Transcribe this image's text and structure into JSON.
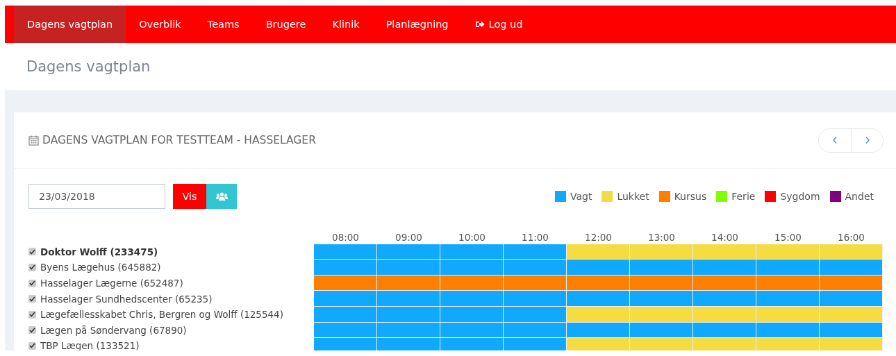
{
  "nav": [
    {
      "label": "Dagens vagtplan",
      "selected": true,
      "kind": "link"
    },
    {
      "label": "Overblik",
      "selected": false,
      "kind": "link"
    },
    {
      "label": "Teams",
      "selected": false,
      "kind": "link"
    },
    {
      "label": "Brugere",
      "selected": false,
      "kind": "link"
    },
    {
      "label": "Klinik",
      "selected": false,
      "kind": "link"
    },
    {
      "label": "Planlægning",
      "selected": false,
      "kind": "link"
    },
    {
      "label": "Log ud",
      "selected": false,
      "kind": "logout"
    }
  ],
  "page_title": "Dagens vagtplan",
  "card": {
    "title": "DAGENS VAGTPLAN FOR TESTTEAM - HASSELAGER",
    "date_field": {
      "value": "23/03/2018"
    },
    "show_button": "Vis",
    "legend": [
      {
        "label": "Vagt",
        "color": "#10a9fe"
      },
      {
        "label": "Lukket",
        "color": "#f4dc42"
      },
      {
        "label": "Kursus",
        "color": "#ff8000"
      },
      {
        "label": "Ferie",
        "color": "#80ff00"
      },
      {
        "label": "Sygdom",
        "color": "#ff0000"
      },
      {
        "label": "Andet",
        "color": "#800080"
      }
    ],
    "hours": [
      "08:00",
      "09:00",
      "10:00",
      "11:00",
      "12:00",
      "13:00",
      "14:00",
      "15:00",
      "16:00"
    ],
    "rows": [
      {
        "name": "Doktor Wolff (233475)",
        "checked": true,
        "selected": true,
        "slots": [
          {
            "color": "#10a9fe"
          },
          {
            "color": "#10a9fe"
          },
          {
            "color": "#10a9fe"
          },
          {
            "color": "#10a9fe"
          },
          {
            "color": "#f4dc42"
          },
          {
            "color": "#f4dc42"
          },
          {
            "color": "#f4dc42"
          },
          {
            "color": "#f4dc42"
          },
          {
            "color": "#f4dc42"
          }
        ]
      },
      {
        "name": "Byens Lægehus (645882)",
        "checked": true,
        "selected": false,
        "slots": [
          {
            "color": "#10a9fe"
          },
          {
            "color": "#10a9fe"
          },
          {
            "color": "#10a9fe"
          },
          {
            "color": "#10a9fe"
          },
          {
            "color": "#10a9fe"
          },
          {
            "color": "#10a9fe"
          },
          {
            "color": "#10a9fe"
          },
          {
            "color": "#10a9fe"
          },
          {
            "color": "#10a9fe"
          }
        ]
      },
      {
        "name": "Hasselager Lægerne (652487)",
        "checked": true,
        "selected": false,
        "slots": [
          {
            "color": "#ff8000"
          },
          {
            "color": "#ff8000"
          },
          {
            "color": "#ff8000"
          },
          {
            "color": "#ff8000"
          },
          {
            "color": "#ff8000"
          },
          {
            "color": "#ff8000"
          },
          {
            "color": "#ff8000"
          },
          {
            "color": "#ff8000"
          },
          {
            "color": "#ff8000"
          }
        ]
      },
      {
        "name": "Hasselager Sundhedscenter (65235)",
        "checked": true,
        "selected": false,
        "slots": [
          {
            "color": "#10a9fe"
          },
          {
            "color": "#10a9fe"
          },
          {
            "color": "#10a9fe"
          },
          {
            "color": "#10a9fe"
          },
          {
            "color": "#10a9fe"
          },
          {
            "color": "#10a9fe"
          },
          {
            "color": "#10a9fe"
          },
          {
            "color": "#10a9fe"
          },
          {
            "color": "#10a9fe"
          }
        ]
      },
      {
        "name": "Lægefællesskabet Chris, Bergren og Wolff (125544)",
        "checked": true,
        "selected": false,
        "slots": [
          {
            "color": "#10a9fe"
          },
          {
            "color": "#10a9fe"
          },
          {
            "color": "#10a9fe"
          },
          {
            "color": "#10a9fe"
          },
          {
            "color": "#f4dc42"
          },
          {
            "color": "#f4dc42"
          },
          {
            "color": "#f4dc42"
          },
          {
            "color": "#f4dc42"
          },
          {
            "color": "#f4dc42"
          }
        ]
      },
      {
        "name": "Lægen på Søndervang (67890)",
        "checked": true,
        "selected": false,
        "slots": [
          {
            "color": "#10a9fe"
          },
          {
            "color": "#10a9fe"
          },
          {
            "color": "#10a9fe"
          },
          {
            "color": "#10a9fe"
          },
          {
            "color": "#10a9fe"
          },
          {
            "color": "#10a9fe"
          },
          {
            "color": "#10a9fe"
          },
          {
            "color": "#10a9fe"
          },
          {
            "color": "#10a9fe"
          }
        ]
      },
      {
        "name": "TBP Lægen (133521)",
        "checked": true,
        "selected": false,
        "slots": [
          {
            "color": "#10a9fe"
          },
          {
            "color": "#10a9fe"
          },
          {
            "color": "#10a9fe"
          },
          {
            "color": "#10a9fe"
          },
          {
            "color": "#f4dc42"
          },
          {
            "color": "#f4dc42"
          },
          {
            "color": "#f4dc42"
          },
          {
            "color": "#f4dc42"
          },
          {
            "color": "#f4dc42"
          }
        ]
      }
    ]
  }
}
